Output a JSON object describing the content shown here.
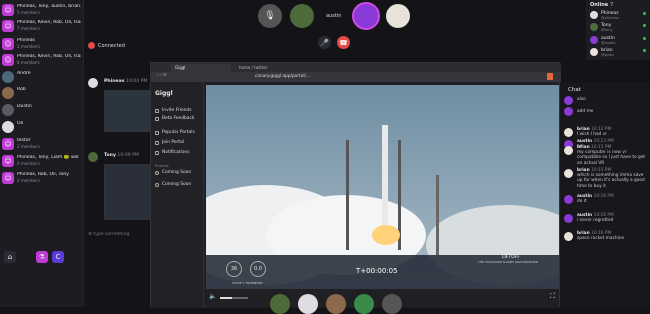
{
  "sidebar": {
    "rooms": [
      {
        "title": "Phineas, Tony, austin, brian...",
        "sub": "5 members",
        "icon": "room-icon"
      },
      {
        "title": "Phineas, Kevin, Rob, Oli, Isaiah...",
        "sub": "7 members",
        "icon": "room-icon"
      },
      {
        "title": "Phineas",
        "sub": "2 members",
        "icon": "room-icon"
      },
      {
        "title": "Phineas, Kevin, Rob, Oli, Isaiah...",
        "sub": "8 members",
        "icon": "room-icon"
      },
      {
        "title": "Andre",
        "sub": "",
        "icon": "avatar"
      },
      {
        "title": "Rob",
        "sub": "",
        "icon": "avatar"
      },
      {
        "title": "Dustin",
        "sub": "",
        "icon": "avatar"
      },
      {
        "title": "Oli",
        "sub": "",
        "icon": "avatar"
      },
      {
        "title": "testar",
        "sub": "2 members",
        "icon": "room-icon"
      },
      {
        "title": "Phineas, Tony, Liam 🐸 will",
        "sub": "4 members",
        "icon": "room-icon"
      },
      {
        "title": "Phineas, Rob, Oli, Tony",
        "sub": "4 members",
        "icon": "room-icon"
      }
    ]
  },
  "call": {
    "status": "Connected",
    "participant_label": "austin"
  },
  "chat_feed": {
    "messages": [
      {
        "author": "Phineas",
        "time": "10:04 PM"
      },
      {
        "author": "Tony",
        "time": "10:09 PM"
      }
    ],
    "input_placeholder": "type something"
  },
  "online": {
    "title": "Online",
    "count": "7",
    "users": [
      {
        "name": "Phineas",
        "sub": "@phineas"
      },
      {
        "name": "Tony",
        "sub": "@tony"
      },
      {
        "name": "austin",
        "sub": "@austin"
      },
      {
        "name": "brian",
        "sub": "@brian"
      }
    ]
  },
  "browser": {
    "tab_title": "Giggl",
    "tab2_title": "home / twitter",
    "url": "canary.giggl.app/portal/..."
  },
  "giggl_sidebar": {
    "logo": "Giggl",
    "nav": [
      "Invite Friends",
      "Beta Feedback",
      "Popular Portals",
      "Join Portal",
      "Notifications"
    ],
    "friends_label": "Friends",
    "friends": [
      "Coming Soon",
      "Coming Soon"
    ]
  },
  "video": {
    "speed": "36",
    "altitude": "0.0",
    "stage_label": "STAGE 1 TELEMETRY",
    "timer": "T+00:00:05",
    "event": "LIFTOFF",
    "event_sub": "THE HOLDDOWN CLAMPS HAVE RELEASED"
  },
  "chat": {
    "title": "Chat",
    "messages": [
      {
        "author": "",
        "time": "",
        "text": "also"
      },
      {
        "author": "",
        "time": "",
        "text": "add me"
      },
      {
        "author": "brian",
        "time": "10:12 PM",
        "text": "I wish I had vr"
      },
      {
        "author": "austin",
        "time": "10:13 PM",
        "text": "no"
      },
      {
        "author": "brian",
        "time": "10:15 PM",
        "text": "my computer is now vr compatible so I just have to get an actual VR"
      },
      {
        "author": "brian",
        "time": "10:15 PM",
        "text": "which is something imma save up for when it's actually a good time to buy it"
      },
      {
        "author": "austin",
        "time": "10:16 PM",
        "text": "do it"
      },
      {
        "author": "austin",
        "time": "10:16 PM",
        "text": "i never regretted"
      },
      {
        "author": "brian",
        "time": "10:16 PM",
        "text": "space rocket machine"
      }
    ]
  },
  "colors": {
    "accent": "#c03ad6",
    "danger": "#e34b4b",
    "online": "#3fbf4f"
  }
}
